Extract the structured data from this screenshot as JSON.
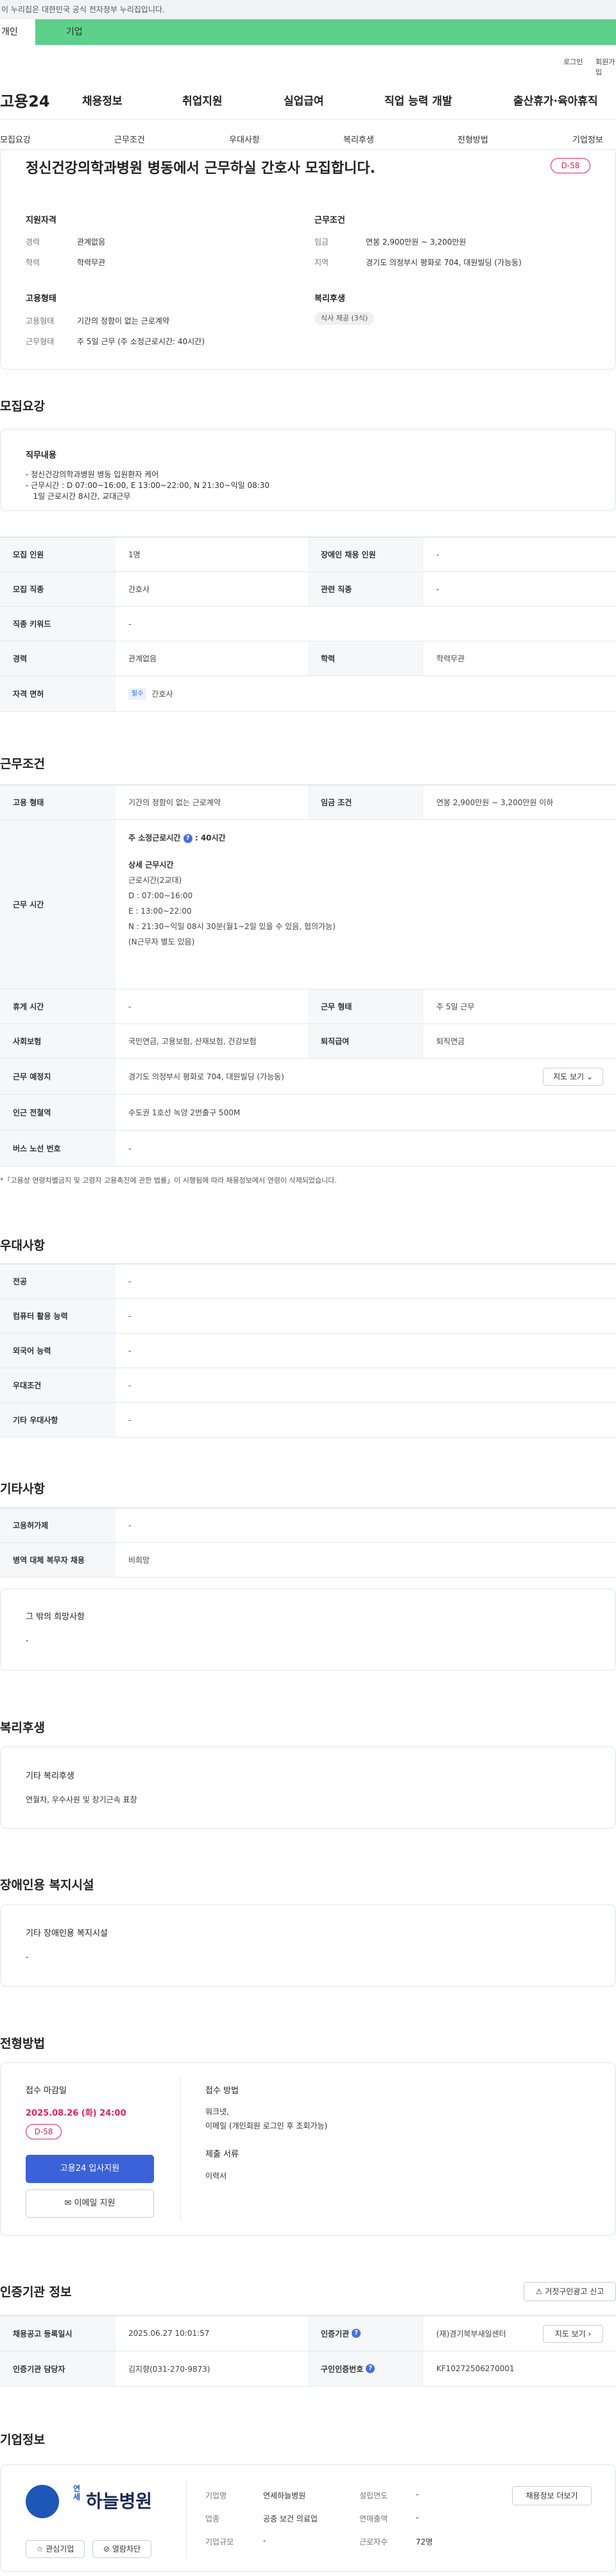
{
  "gov_banner": "이 누리집은 대한민국 공식 전자정부 누리집입니다.",
  "user_tabs": {
    "personal": "개인",
    "company": "기업"
  },
  "top_links": {
    "login": "로그인",
    "join": "회원가입"
  },
  "logo": "고용24",
  "gnb": [
    "채용정보",
    "취업지원",
    "실업급여",
    "직업 능력 개발",
    "출산휴가·육아휴직"
  ],
  "subnav": [
    "모집요강",
    "근무조건",
    "우대사항",
    "복리후생",
    "전형방법",
    "기업정보"
  ],
  "summary": {
    "title": "정신건강의학과병원 병동에서 근무하실 간호사 모집합니다.",
    "dday": "D-58",
    "qual_title": "지원자격",
    "career_label": "경력",
    "career": "관계없음",
    "edu_label": "학력",
    "edu": "학력무관",
    "cond_title": "근무조건",
    "wage_label": "임금",
    "wage": "연봉 2,900만원 ~ 3,200만원",
    "area_label": "지역",
    "area": "경기도 의정부시 평화로 704, 대원빌딩 (가능동)",
    "emp_title": "고용형태",
    "emp_type_label": "고용형태",
    "emp_type": "기간의 정함이 없는 근로계약",
    "work_form_label": "근무형태",
    "work_form": "주 5일 근무 (주 소정근로시간: 40시간)",
    "welfare_title": "복리후생",
    "welfare_pill": "식사 제공 (3식)"
  },
  "recruit": {
    "section": "모집요강",
    "job_title": "직무내용",
    "job_lines": [
      "- 정신건강의학과병원 병동 입원환자 케어",
      "- 근무시간 : D 07:00~16:00, E 13:00~22:00, N 21:30~익일 08:30",
      "   1일 근로시간 8시간, 교대근무"
    ],
    "rows": [
      {
        "h1": "모집 인원",
        "v1": "1명",
        "h2": "장애인 채용 인원",
        "v2": "-"
      },
      {
        "h1": "모집 직종",
        "v1": "간호사",
        "h2": "관련 직종",
        "v2": "-"
      },
      {
        "h1": "직종 키워드",
        "v1": "-"
      },
      {
        "h1": "경력",
        "v1": "관계없음",
        "h2": "학력",
        "v2": "학력무관"
      }
    ],
    "license_label": "자격 면허",
    "license_badge": "필수",
    "license": "간호사"
  },
  "conditions": {
    "section": "근무조건",
    "emp_label": "고용 형태",
    "emp": "기간의 정함이 없는 근로계약",
    "wage_label": "임금 조건",
    "wage": "연봉 2,900만원 ~ 3,200만원 이하",
    "hours_label": "근무 시간",
    "hours_main": "주 소정근로시간",
    "hours_value": ": 40시간",
    "hours_detail_title": "상세 근무시간",
    "hours_detail": [
      "근로시간(2교대)",
      "D :  07:00~16:00",
      "E :  13:00~22:00",
      "N : 21:30~익일 08시 30분(월1~2일 있을 수 있음, 협의가능)",
      "(N근무자 별도 있음)"
    ],
    "break_label": "휴게 시간",
    "break": "-",
    "form_label": "근무 형태",
    "form": "주 5일 근무",
    "ins_label": "사회보험",
    "ins": "국민연금, 고용보험, 산재보험, 건강보험",
    "sev_label": "퇴직급여",
    "sev": "퇴직연금",
    "place_label": "근무 예정지",
    "place": "경기도 의정부시 평화로 704, 대원빌딩 (가능동)",
    "map_btn": "지도 보기",
    "station_label": "인근 전철역",
    "station": "수도권 1호선 녹양 2번출구 500M",
    "bus_label": "버스 노선 번호",
    "bus": "-",
    "note": "*「고용상 연령차별금지 및 고령자 고용촉진에 관한 법률」이 시행됨에 따라 채용정보에서 연령이 삭제되었습니다."
  },
  "preference": {
    "section": "우대사항",
    "rows": [
      {
        "h": "전공",
        "v": "-"
      },
      {
        "h": "컴퓨터 활용 능력",
        "v": "-"
      },
      {
        "h": "외국어 능력",
        "v": "-"
      },
      {
        "h": "우대조건",
        "v": "-"
      },
      {
        "h": "기타 우대사항",
        "v": "-"
      }
    ]
  },
  "etc": {
    "section": "기타사항",
    "rows": [
      {
        "h": "고용허가제",
        "v": "-"
      },
      {
        "h": "병역 대체 복무자 채용",
        "v": "비희망"
      }
    ],
    "box_title": "그 밖의 희망사항",
    "box_value": "-"
  },
  "welfare": {
    "section": "복리후생",
    "box_title": "기타 복리후생",
    "box_value": "연월차, 우수사원 및 장기근속 표창"
  },
  "disability": {
    "section": "장애인용 복지시설",
    "box_title": "기타 장애인용 복지시설",
    "box_value": "-"
  },
  "process": {
    "section": "전형방법",
    "deadline_label": "접수 마감일",
    "deadline": "2025.08.26 (화) 24:00",
    "dday": "D-58",
    "apply_btn": "고용24 입사지원",
    "email_btn": "이메일 지원",
    "method_label": "접수 방법",
    "method": "워크넷,",
    "method2": "이메일 (개인회원 로그인 후 조회가능)",
    "docs_label": "제출 서류",
    "docs": "이력서"
  },
  "agency": {
    "section": "인증기관 정보",
    "report_btn": "거짓구인광고 신고",
    "reg_label": "채용공고 등록일시",
    "reg": "2025.06.27 10:01:57",
    "agency_label": "인증기관",
    "agency": "(재)경기북부새일센터",
    "map_btn": "지도 보기",
    "manager_label": "인증기관 담당자",
    "manager": "김지향(031-270-9873)",
    "cert_label": "구인인증번호",
    "cert": "KF10272506270001"
  },
  "company": {
    "section": "기업정보",
    "logo_small": "연세",
    "logo_name": "하늘병원",
    "fav_btn": "관심기업",
    "block_btn": "열람차단",
    "name_label": "기업명",
    "name": "연세하늘병원",
    "est_label": "설립연도",
    "est": "-",
    "ind_label": "업종",
    "ind": "공중 보건 의료업",
    "sales_label": "연매출액",
    "sales": "-",
    "size_label": "기업규모",
    "size": "-",
    "emp_label": "근로자수",
    "emp": "72명",
    "jobs_btn": "채용정보 더보기"
  }
}
